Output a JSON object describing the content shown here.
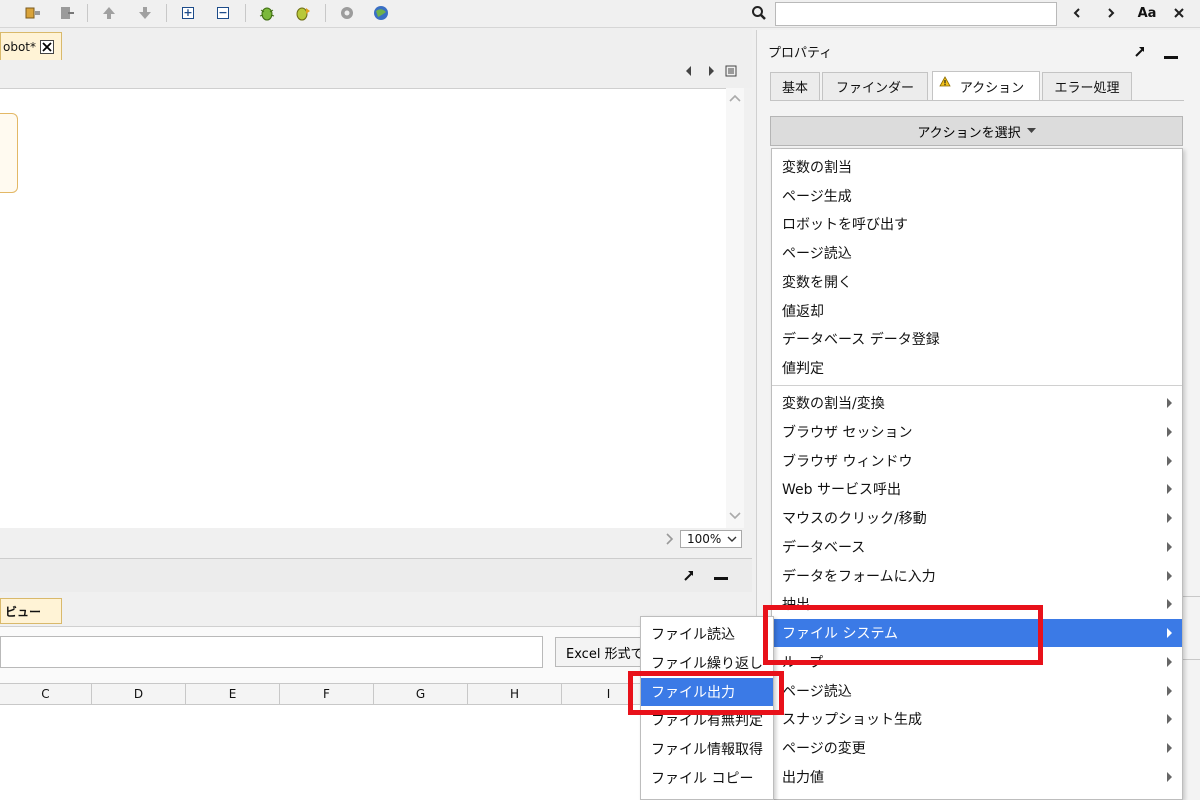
{
  "toolbar": {
    "search_placeholder": "",
    "font_label": "Aa"
  },
  "editor": {
    "tab_label": "obot*",
    "zoom": "100%"
  },
  "bottom": {
    "tab_label": "ビュー",
    "excel_label": "Excel 形式で",
    "columns": [
      "C",
      "D",
      "E",
      "F",
      "G",
      "H",
      "I"
    ]
  },
  "props": {
    "title": "プロパティ",
    "tabs": [
      "基本",
      "ファインダー",
      "アクション",
      "エラー処理"
    ],
    "action_select_label": "アクションを選択",
    "menu_top": [
      "変数の割当",
      "ページ生成",
      "ロボットを呼び出す",
      "ページ読込",
      "変数を開く",
      "値返却",
      "データベース データ登録",
      "値判定"
    ],
    "menu_sub": [
      "変数の割当/変換",
      "ブラウザ セッション",
      "ブラウザ ウィンドウ",
      "Web サービス呼出",
      "マウスのクリック/移動",
      "データベース",
      "データをフォームに入力",
      "抽出",
      "ファイル システム",
      "ループ",
      "ページ読込",
      "スナップショット生成",
      "ページの変更",
      "出力値"
    ]
  },
  "file_submenu": [
    "ファイル読込",
    "ファイル繰り返し",
    "ファイル出力",
    "ファイル有無判定",
    "ファイル情報取得",
    "ファイル コピー"
  ],
  "colors": {
    "highlight": "#3b7ae6",
    "annotation": "#e8111a"
  }
}
